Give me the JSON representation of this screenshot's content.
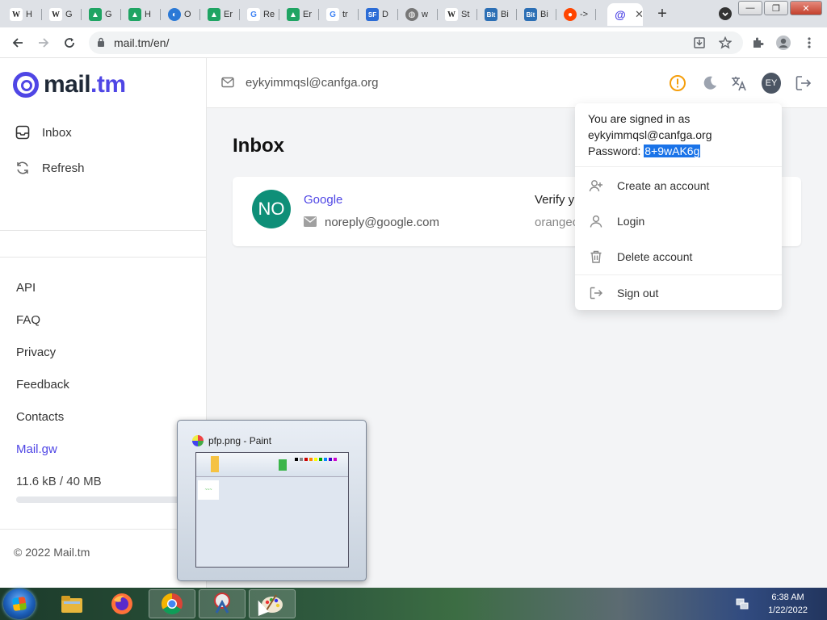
{
  "browser": {
    "tabs": [
      {
        "icon": "W",
        "title": "H",
        "color": "#555555"
      },
      {
        "icon": "W",
        "title": "G",
        "color": "#555555"
      },
      {
        "icon": "drive",
        "title": "G",
        "color": "#1fa463"
      },
      {
        "icon": "drive",
        "title": "H",
        "color": "#1fa463"
      },
      {
        "icon": "cc",
        "title": "O",
        "color": "#2b79d6"
      },
      {
        "icon": "drive",
        "title": "Er",
        "color": "#1fa463"
      },
      {
        "icon": "G",
        "title": "Re",
        "color": "#4285f4"
      },
      {
        "icon": "drive",
        "title": "Er",
        "color": "#1fa463"
      },
      {
        "icon": "G",
        "title": "tr",
        "color": "#4285f4"
      },
      {
        "icon": "SF",
        "title": "D",
        "color": "#2b6cd6"
      },
      {
        "icon": "globe",
        "title": "w",
        "color": "#777777"
      },
      {
        "icon": "W",
        "title": "St",
        "color": "#555555"
      },
      {
        "icon": "Bit",
        "title": "Bi",
        "color": "#2c6fb5"
      },
      {
        "icon": "Bit",
        "title": "Bi",
        "color": "#2c6fb5"
      },
      {
        "icon": "reddit",
        "title": "->",
        "color": "#ff4500"
      }
    ],
    "active_tab_close": "✕",
    "new_tab": "+",
    "url": "mail.tm/en/"
  },
  "sidebar": {
    "logo_text": "mail",
    "logo_tld": ".tm",
    "nav": [
      {
        "label": "Inbox",
        "icon": "inbox-icon"
      },
      {
        "label": "Refresh",
        "icon": "refresh-icon"
      }
    ],
    "links": [
      "API",
      "FAQ",
      "Privacy",
      "Feedback",
      "Contacts"
    ],
    "brand_link": "Mail.gw",
    "quota_text": "11.6 kB  / 40 MB",
    "quota_fraction": 0.0003,
    "copyright": "© 2022 Mail.tm"
  },
  "header": {
    "email": "eykyimmqsl@canfga.org",
    "avatar_initials": "EY"
  },
  "main": {
    "title": "Inbox",
    "messages": [
      {
        "avatar": "NO",
        "sender": "Google",
        "address": "noreply@google.com",
        "subject": "Verify y",
        "preview": "orangec"
      }
    ]
  },
  "dropdown": {
    "signed_in_label": "You are signed in as",
    "email": "eykyimmqsl@canfga.org",
    "password_label": "Password: ",
    "password": "8+9wAK6g",
    "items": [
      {
        "label": "Create an account",
        "icon": "add-user-icon"
      },
      {
        "label": "Login",
        "icon": "user-icon"
      },
      {
        "label": "Delete account",
        "icon": "trash-icon"
      },
      {
        "label": "Sign out",
        "icon": "sign-out-icon"
      }
    ]
  },
  "taskbar": {
    "thumbnail_title": "pfp.png - Paint",
    "time": "6:38 AM",
    "date": "1/22/2022"
  }
}
